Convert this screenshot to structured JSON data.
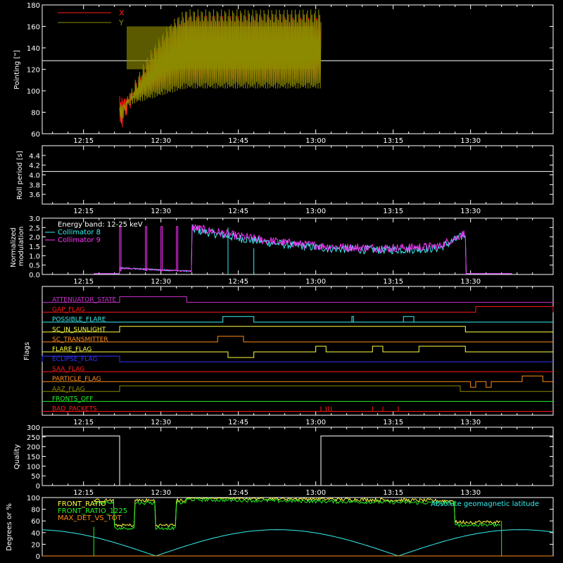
{
  "time_ticks": [
    "12:15",
    "12:30",
    "12:45",
    "13:00",
    "13:15",
    "13:30"
  ],
  "colors": {
    "bg": "#000000",
    "axis": "#ffffff",
    "red": "#ff1a1a",
    "olive": "#8c8a00",
    "cyan": "#36f0f0",
    "magenta": "#ff33ff",
    "yellow": "#ffff40",
    "green": "#22ee22",
    "orange": "#ff8c1a",
    "blue": "#3333ff",
    "purple": "#cc33cc"
  },
  "chart_data": [
    {
      "type": "line",
      "name": "pointing",
      "ylabel": "Pointing [\"]",
      "ylim": [
        60,
        180
      ],
      "yticks": [
        "60",
        "80",
        "100",
        "120",
        "140",
        "160",
        "180"
      ],
      "reference_line": 128,
      "legend": [
        "X",
        "Y"
      ],
      "x_start": "12:22",
      "x_end": "13:01",
      "x_series_band": {
        "start_min": [
          95,
          65
        ],
        "settle_min": [
          115,
          128
        ],
        "end_max": [
          165,
          160
        ]
      },
      "y_series_band": {
        "start_min": [
          90,
          70
        ],
        "settle_min": [
          108,
          130
        ],
        "end_max": [
          170,
          165
        ]
      }
    },
    {
      "type": "line",
      "name": "roll-period",
      "ylabel": "Roll period [s]",
      "ylim": [
        3.4,
        4.6
      ],
      "yticks": [
        "3.6",
        "3.8",
        "4.0",
        "4.2",
        "4.4"
      ],
      "value": 4.07
    },
    {
      "type": "line",
      "name": "modulation",
      "ylabel": "Normalized modulation",
      "ylim": [
        0,
        3.0
      ],
      "yticks": [
        "0.0",
        "0.5",
        "1.0",
        "1.5",
        "2.0",
        "2.5",
        "3.0"
      ],
      "legend_title": "Energy band: 12-25 keV",
      "series": [
        {
          "name": "Collimator 8",
          "color": "cyan"
        },
        {
          "name": "Collimator 9",
          "color": "magenta"
        }
      ]
    },
    {
      "type": "flags",
      "name": "flags",
      "ylabel": "Flags",
      "rows": [
        {
          "label": "ATTENUATOR_STATE",
          "color": "purple"
        },
        {
          "label": "GAP_FLAG",
          "color": "red"
        },
        {
          "label": "POSSIBLE_FLARE",
          "color": "cyan"
        },
        {
          "label": "SC_IN_SUNLIGHT",
          "color": "yellow"
        },
        {
          "label": "SC_TRANSMITTER",
          "color": "orange"
        },
        {
          "label": "FLARE_FLAG",
          "color": "yellow"
        },
        {
          "label": "ECLIPSE_FLAG",
          "color": "blue"
        },
        {
          "label": "SAA_FLAG",
          "color": "red"
        },
        {
          "label": "PARTICLE_FLAG",
          "color": "orange"
        },
        {
          "label": "AAZ_FLAG",
          "color": "olive"
        },
        {
          "label": "FRONTS_OFF",
          "color": "green"
        },
        {
          "label": "BAD_PACKETS",
          "color": "red"
        }
      ]
    },
    {
      "type": "line",
      "name": "quality",
      "ylabel": "Quality",
      "ylim": [
        0,
        300
      ],
      "yticks": [
        "0",
        "50",
        "100",
        "150",
        "200",
        "250",
        "300"
      ],
      "high_value": 255,
      "segments": [
        [
          "12:07",
          "12:22"
        ],
        [
          "13:01",
          "13:46"
        ]
      ]
    },
    {
      "type": "line",
      "name": "ratios",
      "ylabel": "Degrees or %",
      "ylim": [
        0,
        100
      ],
      "yticks": [
        "0",
        "20",
        "40",
        "60",
        "80",
        "100"
      ],
      "legend": [
        {
          "name": "FRONT_RATIO",
          "color": "yellow"
        },
        {
          "name": "FRONT_RATIO_1225",
          "color": "green"
        },
        {
          "name": "MAX_DET_VS_TOT",
          "color": "orange"
        }
      ],
      "annotation": {
        "text": "Absolute geomagnetic latitude",
        "color": "cyan"
      }
    }
  ]
}
